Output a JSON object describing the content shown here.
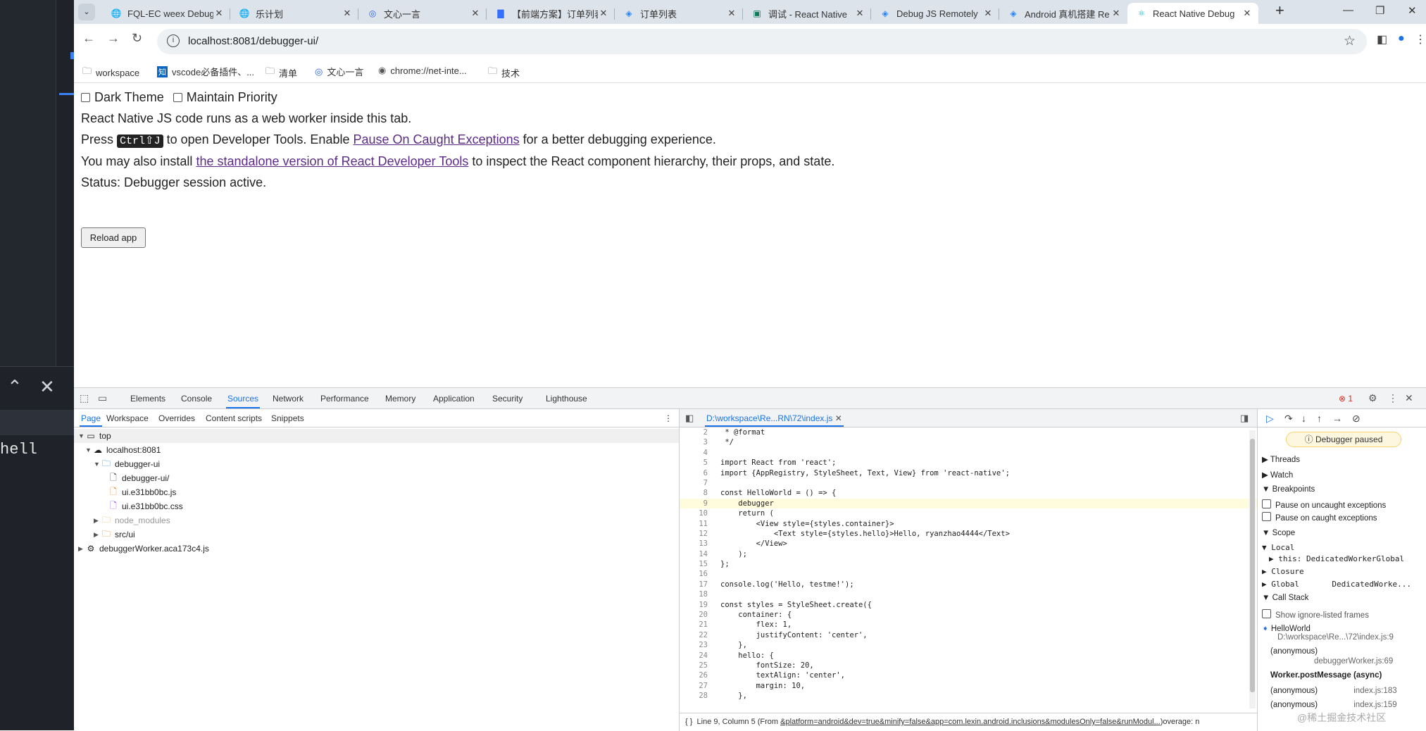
{
  "left_app": {
    "shell_text": "hell"
  },
  "tabs": [
    {
      "title": "FQL-EC weex Debug",
      "icon": "globe-icon"
    },
    {
      "title": "乐计划",
      "icon": "globe-icon"
    },
    {
      "title": "文心一言",
      "icon": "ernie-logo-icon"
    },
    {
      "title": "【前端方案】订单列表",
      "icon": "doc-icon"
    },
    {
      "title": "订单列表",
      "icon": "diamond-icon"
    },
    {
      "title": "调试 - React Native",
      "icon": "app-icon"
    },
    {
      "title": "Debug JS Remotely",
      "icon": "diamond-icon"
    },
    {
      "title": "Android 真机搭建 Re",
      "icon": "diamond-icon"
    },
    {
      "title": "React Native Debug",
      "icon": "react-icon"
    }
  ],
  "address_bar": {
    "url": "localhost:8081/debugger-ui/"
  },
  "bookmarks": [
    {
      "label": "workspace",
      "icon": "folder-icon"
    },
    {
      "label": "vscode必备插件、...",
      "icon": "zhihu-icon"
    },
    {
      "label": "清单",
      "icon": "folder-icon"
    },
    {
      "label": "文心一言",
      "icon": "ernie-logo-icon"
    },
    {
      "label": "chrome://net-inte...",
      "icon": "chrome-icon"
    },
    {
      "label": "技术",
      "icon": "folder-icon"
    }
  ],
  "page": {
    "dark_theme_label": "Dark Theme",
    "maintain_priority_label": "Maintain Priority",
    "line1": "React Native JS code runs as a web worker inside this tab.",
    "line2_pre": "Press",
    "line2_kbd": "Ctrl⇧J",
    "line2_mid": "to open Developer Tools. Enable",
    "line2_link": "Pause On Caught Exceptions",
    "line2_post": "for a better debugging experience.",
    "line3_pre": "You may also install",
    "line3_link": "the standalone version of React Developer Tools",
    "line3_post": "to inspect the React component hierarchy, their props, and state.",
    "status": "Status: Debugger session active.",
    "reload_button": "Reload app"
  },
  "devtools": {
    "main_tabs": [
      "Elements",
      "Console",
      "Sources",
      "Network",
      "Performance",
      "Memory",
      "Application",
      "Security",
      "Lighthouse"
    ],
    "active_tab": "Sources",
    "error_count": "1",
    "nav_tabs": [
      "Page",
      "Workspace",
      "Overrides",
      "Content scripts",
      "Snippets"
    ],
    "tree": {
      "top": "top",
      "host": "localhost:8081",
      "folder": "debugger-ui",
      "file1": "debugger-ui/",
      "file2": "ui.e31bb0bc.js",
      "file3": "ui.e31bb0bc.css",
      "node_modules": "node_modules",
      "srcui": "src/ui",
      "worker": "debuggerWorker.aca173c4.js"
    },
    "file_tab": "D:\\workspace\\Re...RN\\72\\index.js",
    "code_lines": [
      {
        "n": "2",
        "t": " * @format"
      },
      {
        "n": "3",
        "t": " */"
      },
      {
        "n": "4",
        "t": ""
      },
      {
        "n": "5",
        "t": "import React from 'react';"
      },
      {
        "n": "6",
        "t": "import {AppRegistry, StyleSheet, Text, View} from 'react-native';"
      },
      {
        "n": "7",
        "t": ""
      },
      {
        "n": "8",
        "t": "const HelloWorld = () => {"
      },
      {
        "n": "9",
        "t": "    debugger"
      },
      {
        "n": "10",
        "t": "    return ("
      },
      {
        "n": "11",
        "t": "        <View style={styles.container}>"
      },
      {
        "n": "12",
        "t": "            <Text style={styles.hello}>Hello, ryanzhao4444</Text>"
      },
      {
        "n": "13",
        "t": "        </View>"
      },
      {
        "n": "14",
        "t": "    );"
      },
      {
        "n": "15",
        "t": "};"
      },
      {
        "n": "16",
        "t": ""
      },
      {
        "n": "17",
        "t": "console.log('Hello, testme!');"
      },
      {
        "n": "18",
        "t": ""
      },
      {
        "n": "19",
        "t": "const styles = StyleSheet.create({"
      },
      {
        "n": "20",
        "t": "    container: {"
      },
      {
        "n": "21",
        "t": "        flex: 1,"
      },
      {
        "n": "22",
        "t": "        justifyContent: 'center',"
      },
      {
        "n": "23",
        "t": "    },"
      },
      {
        "n": "24",
        "t": "    hello: {"
      },
      {
        "n": "25",
        "t": "        fontSize: 20,"
      },
      {
        "n": "26",
        "t": "        textAlign: 'center',"
      },
      {
        "n": "27",
        "t": "        margin: 10,"
      },
      {
        "n": "28",
        "t": "    },"
      }
    ],
    "highlight_line": "9",
    "status_prefix": "Line 9, Column 5  (From ",
    "status_link": "&platform=android&dev=true&minify=false&app=com.lexin.android.inclusions&modulesOnly=false&runModul...",
    "status_suffix": ")overage: n",
    "debugger": {
      "paused": "Debugger paused",
      "threads": "Threads",
      "watch": "Watch",
      "breakpoints": "Breakpoints",
      "pause_uncaught": "Pause on uncaught exceptions",
      "pause_caught": "Pause on caught exceptions",
      "scope": "Scope",
      "local": "Local",
      "this_row": "this: DedicatedWorkerGlobal",
      "closure": "Closure",
      "global": "Global",
      "global_val": "DedicatedWorke...",
      "call_stack": "Call Stack",
      "show_ignore": "Show ignore-listed frames",
      "frame1": "HelloWorld",
      "frame1_loc": "D:\\workspace\\Re...\\72\\index.js:9",
      "frame2": "(anonymous)",
      "frame2_loc": "debuggerWorker.js:69",
      "frame3": "Worker.postMessage (async)",
      "frame4": "(anonymous)",
      "frame4_loc": "index.js:183",
      "frame5": "(anonymous)",
      "frame5_loc": "index.js:159",
      "watermark": "@稀土掘金技术社区"
    }
  }
}
